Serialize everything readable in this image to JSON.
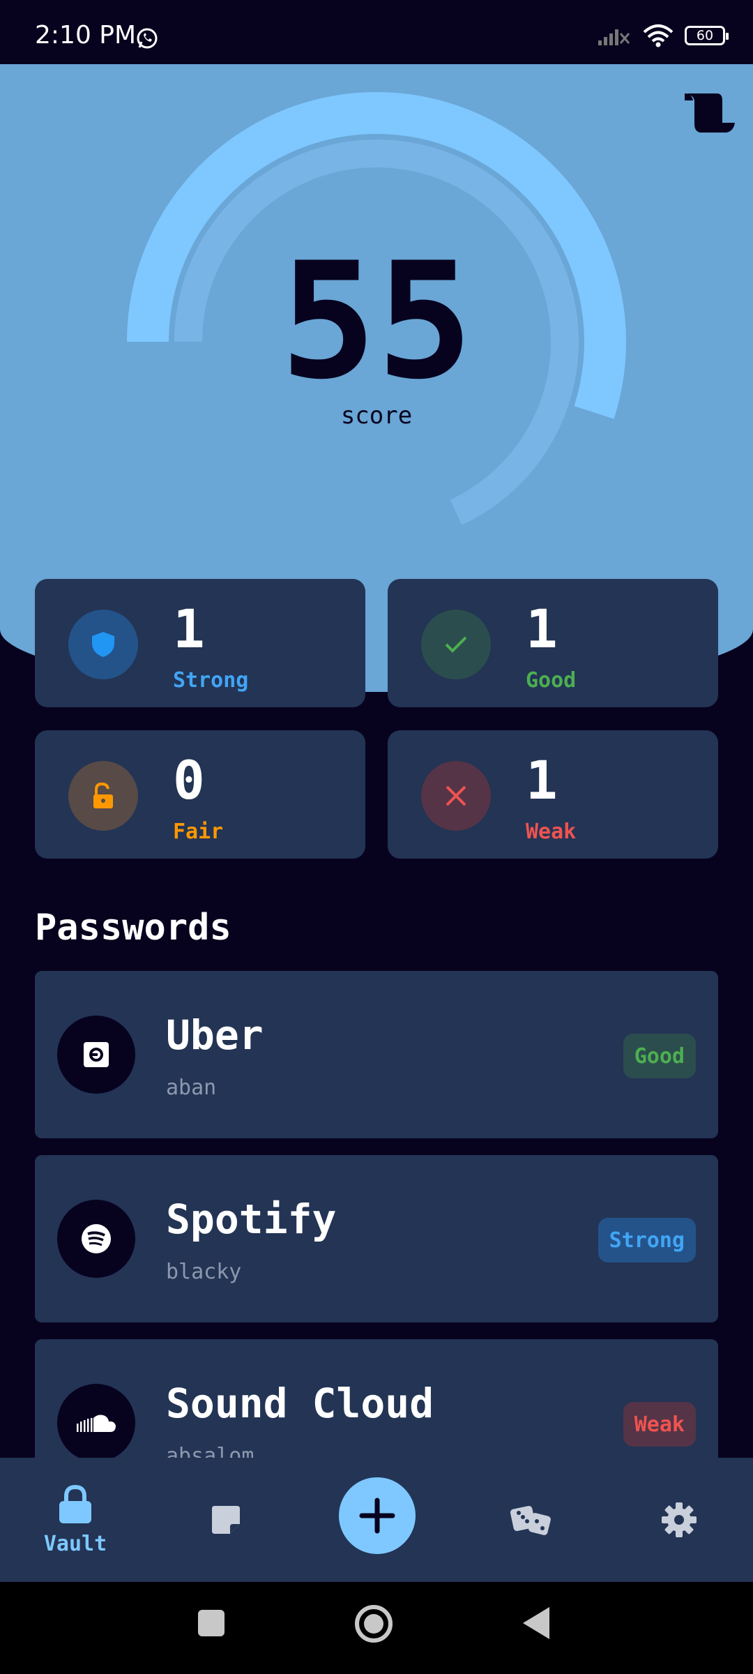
{
  "status_bar": {
    "time": "2:10 PM",
    "battery": "60"
  },
  "score": {
    "value": "55",
    "label": "score",
    "fraction": 0.55
  },
  "stats": [
    {
      "count": "1",
      "label": "Strong",
      "color": "#42a5f5",
      "icon": "shield-icon"
    },
    {
      "count": "1",
      "label": "Good",
      "color": "#4caf50",
      "icon": "check-icon"
    },
    {
      "count": "0",
      "label": "Fair",
      "color": "#ff9800",
      "icon": "unlock-icon"
    },
    {
      "count": "1",
      "label": "Weak",
      "color": "#ef5350",
      "icon": "close-icon"
    }
  ],
  "passwords_title": "Passwords",
  "passwords": [
    {
      "name": "Uber",
      "user": "aban",
      "strength": "Good",
      "icon": "uber-icon"
    },
    {
      "name": "Spotify",
      "user": "blacky",
      "strength": "Strong",
      "icon": "spotify-icon"
    },
    {
      "name": "Sound Cloud",
      "user": "absalom",
      "strength": "Weak",
      "icon": "soundcloud-icon"
    }
  ],
  "bottom_nav": {
    "vault_label": "Vault",
    "items": [
      "lock-icon",
      "note-icon",
      "add-icon",
      "dice-icon",
      "gear-icon"
    ]
  },
  "colors": {
    "accent": "#7ec8ff",
    "hero": "#6aa6d6",
    "card": "#233455",
    "background": "#07031e"
  }
}
